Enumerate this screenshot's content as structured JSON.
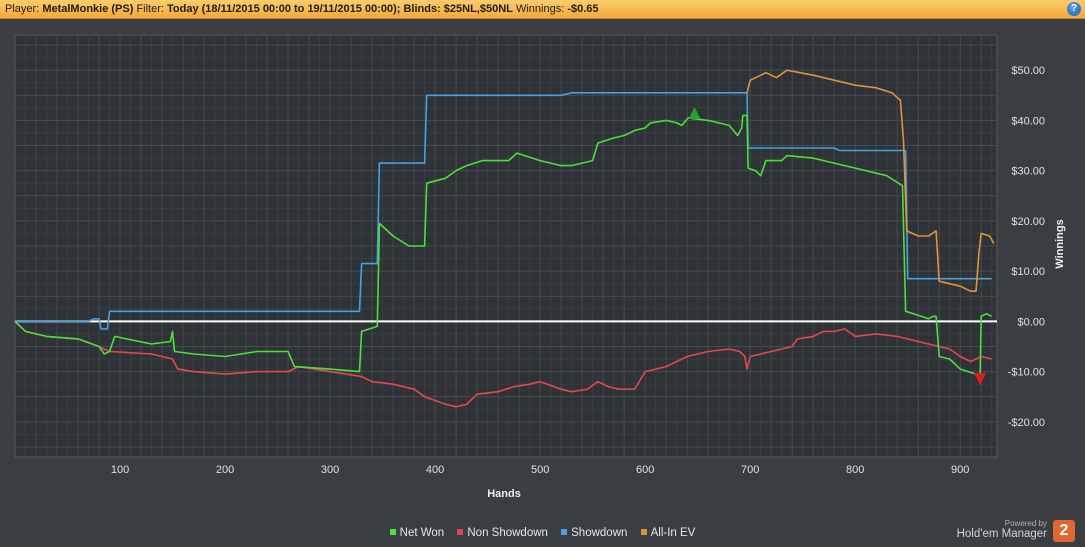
{
  "header": {
    "player_label": "Player:",
    "player_value": "MetalMonkie (PS)",
    "filter_label": "Filter:",
    "filter_value": "Today (18/11/2015 00:00 to 19/11/2015 00:00); Blinds: $25NL,$50NL",
    "winnings_label": "Winnings:",
    "winnings_value": "-$0.65",
    "help_icon": "?"
  },
  "branding": {
    "powered_by": "Powered by",
    "name": "Hold'em Manager",
    "logo_text": "2"
  },
  "chart_data": {
    "type": "line",
    "xlabel": "Hands",
    "ylabel": "Winnings",
    "xlim": [
      0,
      935
    ],
    "ylim": [
      -27,
      57
    ],
    "x_ticks": [
      100,
      200,
      300,
      400,
      500,
      600,
      700,
      800,
      900
    ],
    "y_ticks": [
      50,
      40,
      30,
      20,
      10,
      0,
      -10,
      -20
    ],
    "y_tick_labels": [
      "$50.00",
      "$40.00",
      "$30.00",
      "$20.00",
      "$10.00",
      "$0.00",
      "-$10.00",
      "-$20.00"
    ],
    "grid": true,
    "legend_position": "bottom-center",
    "series": [
      {
        "name": "Net Won",
        "color": "#4be03a",
        "points": [
          [
            0,
            0
          ],
          [
            10,
            -2
          ],
          [
            30,
            -3
          ],
          [
            60,
            -3.5
          ],
          [
            80,
            -5
          ],
          [
            85,
            -6.5
          ],
          [
            90,
            -6
          ],
          [
            95,
            -3
          ],
          [
            130,
            -4.5
          ],
          [
            148,
            -4
          ],
          [
            150,
            -2
          ],
          [
            152,
            -6
          ],
          [
            170,
            -6.5
          ],
          [
            200,
            -7
          ],
          [
            230,
            -6
          ],
          [
            260,
            -6
          ],
          [
            266,
            -9
          ],
          [
            300,
            -9.5
          ],
          [
            328,
            -10
          ],
          [
            330,
            -2
          ],
          [
            345,
            -1
          ],
          [
            347,
            19.5
          ],
          [
            360,
            17
          ],
          [
            375,
            15
          ],
          [
            390,
            15
          ],
          [
            392,
            27.5
          ],
          [
            410,
            28.5
          ],
          [
            420,
            30
          ],
          [
            430,
            31
          ],
          [
            445,
            32
          ],
          [
            470,
            32
          ],
          [
            478,
            33.5
          ],
          [
            500,
            32
          ],
          [
            520,
            31
          ],
          [
            530,
            31
          ],
          [
            540,
            31.5
          ],
          [
            550,
            32
          ],
          [
            555,
            35.5
          ],
          [
            570,
            36.5
          ],
          [
            580,
            37
          ],
          [
            590,
            38
          ],
          [
            600,
            38.5
          ],
          [
            605,
            39.5
          ],
          [
            620,
            40
          ],
          [
            630,
            39.5
          ],
          [
            635,
            39
          ],
          [
            641,
            40.5
          ],
          [
            660,
            40
          ],
          [
            680,
            39
          ],
          [
            688,
            37
          ],
          [
            692,
            38.5
          ],
          [
            693,
            41
          ],
          [
            697,
            41
          ],
          [
            698,
            30.5
          ],
          [
            705,
            30
          ],
          [
            710,
            29
          ],
          [
            715,
            32
          ],
          [
            730,
            32
          ],
          [
            735,
            33
          ],
          [
            760,
            32.5
          ],
          [
            790,
            31
          ],
          [
            810,
            30
          ],
          [
            830,
            29
          ],
          [
            845,
            27
          ],
          [
            848,
            2
          ],
          [
            870,
            0.5
          ],
          [
            874,
            1
          ],
          [
            877,
            1
          ],
          [
            880,
            -7
          ],
          [
            890,
            -7.5
          ],
          [
            900,
            -9.5
          ],
          [
            915,
            -10.5
          ],
          [
            918,
            -11
          ],
          [
            919,
            -10
          ],
          [
            920,
            1
          ],
          [
            925,
            1.5
          ],
          [
            930,
            1
          ]
        ]
      },
      {
        "name": "Non Showdown",
        "color": "#e04a4a",
        "points": [
          [
            0,
            0
          ],
          [
            10,
            -2
          ],
          [
            30,
            -3
          ],
          [
            60,
            -3.5
          ],
          [
            80,
            -5
          ],
          [
            90,
            -6
          ],
          [
            130,
            -6.5
          ],
          [
            150,
            -7.5
          ],
          [
            155,
            -9.5
          ],
          [
            170,
            -10
          ],
          [
            200,
            -10.5
          ],
          [
            230,
            -10
          ],
          [
            260,
            -10
          ],
          [
            270,
            -9
          ],
          [
            300,
            -10
          ],
          [
            330,
            -11
          ],
          [
            340,
            -12
          ],
          [
            360,
            -12.5
          ],
          [
            380,
            -13.5
          ],
          [
            390,
            -15
          ],
          [
            410,
            -16.5
          ],
          [
            420,
            -17
          ],
          [
            430,
            -16.5
          ],
          [
            440,
            -14.5
          ],
          [
            460,
            -14
          ],
          [
            475,
            -13
          ],
          [
            490,
            -12.5
          ],
          [
            500,
            -12
          ],
          [
            520,
            -13.5
          ],
          [
            530,
            -14
          ],
          [
            545,
            -13.5
          ],
          [
            555,
            -12
          ],
          [
            565,
            -13
          ],
          [
            575,
            -13.5
          ],
          [
            590,
            -13.5
          ],
          [
            600,
            -10
          ],
          [
            620,
            -9
          ],
          [
            640,
            -7
          ],
          [
            660,
            -6
          ],
          [
            680,
            -5.5
          ],
          [
            690,
            -6
          ],
          [
            695,
            -7
          ],
          [
            697,
            -9.5
          ],
          [
            700,
            -7
          ],
          [
            720,
            -6
          ],
          [
            740,
            -5
          ],
          [
            745,
            -3.5
          ],
          [
            760,
            -3
          ],
          [
            770,
            -2
          ],
          [
            780,
            -2
          ],
          [
            790,
            -1.5
          ],
          [
            800,
            -3
          ],
          [
            820,
            -2.5
          ],
          [
            840,
            -3
          ],
          [
            860,
            -4
          ],
          [
            880,
            -5
          ],
          [
            890,
            -5.5
          ],
          [
            900,
            -7
          ],
          [
            910,
            -8
          ],
          [
            920,
            -7
          ],
          [
            930,
            -7.5
          ]
        ]
      },
      {
        "name": "Showdown",
        "color": "#4a9fe0",
        "points": [
          [
            0,
            0
          ],
          [
            10,
            0
          ],
          [
            70,
            0
          ],
          [
            75,
            0.5
          ],
          [
            80,
            0.5
          ],
          [
            82,
            -1.5
          ],
          [
            88,
            -1.5
          ],
          [
            90,
            2
          ],
          [
            120,
            2
          ],
          [
            200,
            2
          ],
          [
            300,
            2
          ],
          [
            328,
            2
          ],
          [
            330,
            11.5
          ],
          [
            345,
            11.5
          ],
          [
            347,
            31.5
          ],
          [
            390,
            31.5
          ],
          [
            392,
            45
          ],
          [
            500,
            45
          ],
          [
            520,
            45
          ],
          [
            530,
            45.5
          ],
          [
            600,
            45.5
          ],
          [
            697,
            45.5
          ],
          [
            698,
            34.5
          ],
          [
            760,
            34.5
          ],
          [
            780,
            34.5
          ],
          [
            785,
            34
          ],
          [
            848,
            34
          ],
          [
            850,
            8.5
          ],
          [
            880,
            8.5
          ],
          [
            900,
            8.5
          ],
          [
            930,
            8.5
          ]
        ]
      },
      {
        "name": "All-In EV",
        "color": "#e0943a",
        "points": [
          [
            697,
            45.5
          ],
          [
            700,
            48
          ],
          [
            715,
            49.5
          ],
          [
            725,
            48.5
          ],
          [
            735,
            50
          ],
          [
            760,
            49
          ],
          [
            780,
            48
          ],
          [
            800,
            47
          ],
          [
            820,
            46.5
          ],
          [
            835,
            45.5
          ],
          [
            843,
            44
          ],
          [
            846,
            36
          ],
          [
            849,
            18
          ],
          [
            860,
            17
          ],
          [
            870,
            17
          ],
          [
            877,
            18
          ],
          [
            880,
            8
          ],
          [
            890,
            7.5
          ],
          [
            900,
            7
          ],
          [
            910,
            6
          ],
          [
            915,
            6
          ],
          [
            918,
            14
          ],
          [
            920,
            17.5
          ],
          [
            928,
            17
          ],
          [
            932,
            15.5
          ]
        ]
      }
    ],
    "markers": [
      {
        "type": "max",
        "x": 647,
        "y": 41.5,
        "color": "#22a030"
      },
      {
        "type": "min",
        "x": 919,
        "y": -11.5,
        "color": "#e01e1e"
      }
    ]
  }
}
